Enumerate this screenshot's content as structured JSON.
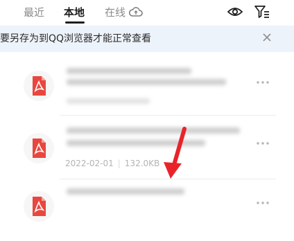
{
  "tabs": [
    {
      "label": "最近",
      "active": false
    },
    {
      "label": "本地",
      "active": true
    },
    {
      "label": "在线",
      "active": false
    }
  ],
  "icons": {
    "online": "cloud-sync-icon",
    "eye": "eye-icon",
    "filter": "filter-icon",
    "close": "close-icon",
    "pdf": "pdf-file-icon",
    "more": "more-dots-icon"
  },
  "notice": {
    "text": "需要另存为到QQ浏览器才能正常查看"
  },
  "files": [
    {
      "meta_date": "",
      "meta_size": ""
    },
    {
      "meta_date": "2022-02-01",
      "meta_size": "132.0KB"
    },
    {
      "meta_date": "",
      "meta_size": ""
    }
  ],
  "colors": {
    "accent_red": "#e8473f",
    "notice_bg": "#edf3fb",
    "arrow_red": "#e8242a"
  }
}
